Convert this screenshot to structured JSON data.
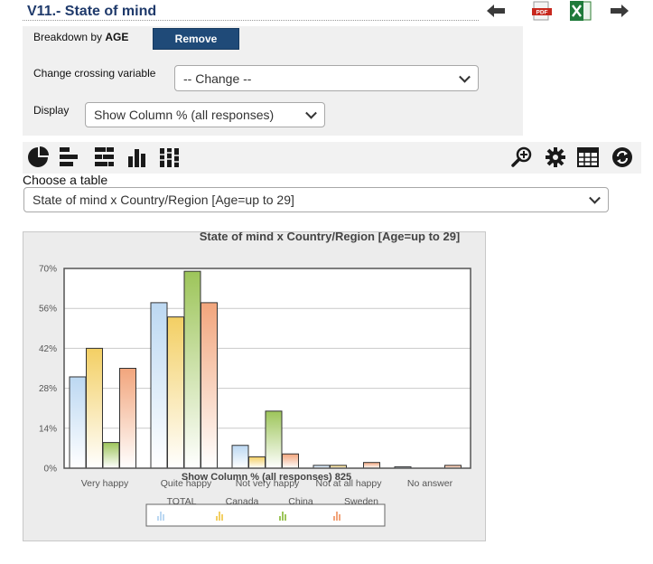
{
  "header": {
    "title": "V11.- State of mind"
  },
  "breakdown": {
    "label_prefix": "Breakdown by ",
    "label_bold": "AGE",
    "remove_label": "Remove",
    "crossing_label": "Change crossing variable",
    "crossing_value": "-- Change --",
    "display_label": "Display",
    "display_value": "Show Column % (all responses)"
  },
  "table_selector": {
    "label": "Choose a table",
    "value": "State of mind x Country/Region [Age=up to 29]"
  },
  "chart_data": {
    "type": "bar",
    "title": "State of mind x Country/Region [Age=up to 29]",
    "xlabel": "Show Column % (all responses) 825",
    "categories": [
      "Very happy",
      "Quite happy",
      "Not very happy",
      "Not at all happy",
      "No answer"
    ],
    "ylim": [
      0,
      70
    ],
    "yticks": [
      "0%",
      "14%",
      "28%",
      "42%",
      "56%",
      "70%"
    ],
    "grid": true,
    "legend_position": "bottom",
    "series": [
      {
        "name": "TOTAL",
        "color": "#bcd8f2",
        "values": [
          32,
          58,
          8,
          1,
          0.5
        ]
      },
      {
        "name": "Canada",
        "color": "#f3cf63",
        "values": [
          42,
          53,
          4,
          1,
          0
        ]
      },
      {
        "name": "China",
        "color": "#9dc55a",
        "values": [
          9,
          69,
          20,
          0,
          0
        ]
      },
      {
        "name": "Sweden",
        "color": "#f2a57c",
        "values": [
          35,
          58,
          5,
          2,
          1
        ]
      }
    ]
  }
}
